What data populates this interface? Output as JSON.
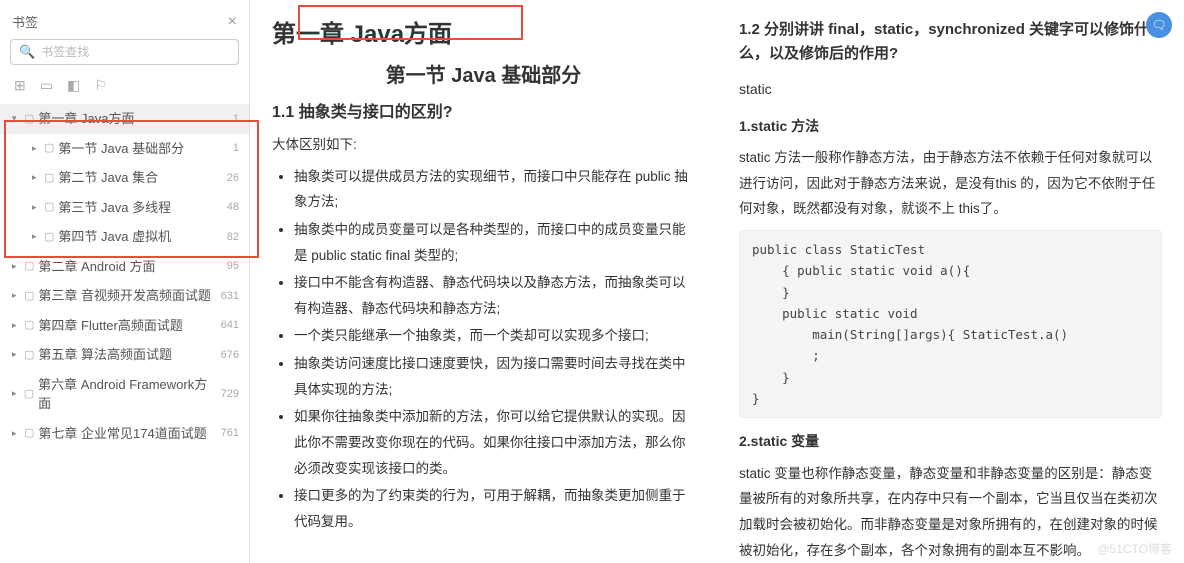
{
  "sidebar": {
    "title": "书签",
    "search_placeholder": "书签查找",
    "items": [
      {
        "label": "第一章 Java方面",
        "page": "1",
        "expanded": true,
        "selected": true,
        "children": [
          {
            "label": "第一节 Java 基础部分",
            "page": "1"
          },
          {
            "label": "第二节 Java 集合",
            "page": "26"
          },
          {
            "label": "第三节 Java 多线程",
            "page": "48"
          },
          {
            "label": "第四节 Java 虚拟机",
            "page": "82"
          }
        ]
      },
      {
        "label": "第二章 Android 方面",
        "page": "95"
      },
      {
        "label": "第三章 音视频开发高频面试题",
        "page": "631"
      },
      {
        "label": "第四章 Flutter高频面试题",
        "page": "641"
      },
      {
        "label": "第五章 算法高频面试题",
        "page": "676"
      },
      {
        "label": "第六章 Android Framework方面",
        "page": "729"
      },
      {
        "label": "第七章 企业常见174道面试题",
        "page": "761"
      }
    ]
  },
  "left": {
    "h1": "第一章 Java方面",
    "h2": "第一节  Java  基础部分",
    "h3": "1.1 抽象类与接口的区别?",
    "intro": "大体区别如下:",
    "bullets": [
      "抽象类可以提供成员方法的实现细节，而接口中只能存在  public 抽象方法;",
      "抽象类中的成员变量可以是各种类型的，而接口中的成员变量只能是  public static final 类型的;",
      "接口中不能含有构造器、静态代码块以及静态方法，而抽象类可以有构造器、静态代码块和静态方法;",
      "一个类只能继承一个抽象类，而一个类却可以实现多个接口;",
      "抽象类访问速度比接口速度要快，因为接口需要时间去寻找在类中具体实现的方法;",
      "如果你往抽象类中添加新的方法，你可以给它提供默认的实现。因此你不需要改变你现在的代码。如果你往接口中添加方法，那么你必须改变实现该接口的类。",
      "接口更多的为了约束类的行为，可用于解耦，而抽象类更加侧重于代码复用。"
    ]
  },
  "right": {
    "h3": "1.2 分别讲讲 final，static，synchronized 关键字可以修饰什么，以及修饰后的作用?",
    "kw": "static",
    "sec1_title": "1.static 方法",
    "sec1_body": "static 方法一般称作静态方法，由于静态方法不依赖于任何对象就可以进行访问，因此对于静态方法来说，是没有this 的，因为它不依附于任何对象，既然都没有对象，就谈不上  this了。",
    "code": "public class StaticTest\n    { public static void a(){\n    }\n    public static void\n        main(String[]args){ StaticTest.a()\n        ;\n    }\n}",
    "sec2_title": "2.static  变量",
    "sec2_body": "static 变量也称作静态变量，静态变量和非静态变量的区别是：静态变量被所有的对象所共享，在内存中只有一个副本，它当且仅当在类初次加载时会被初始化。而非静态变量是对象所拥有的，在创建对象的时候被初始化，存在多个副本，各个对象拥有的副本互不影响。"
  },
  "watermark": "@51CTO博客"
}
